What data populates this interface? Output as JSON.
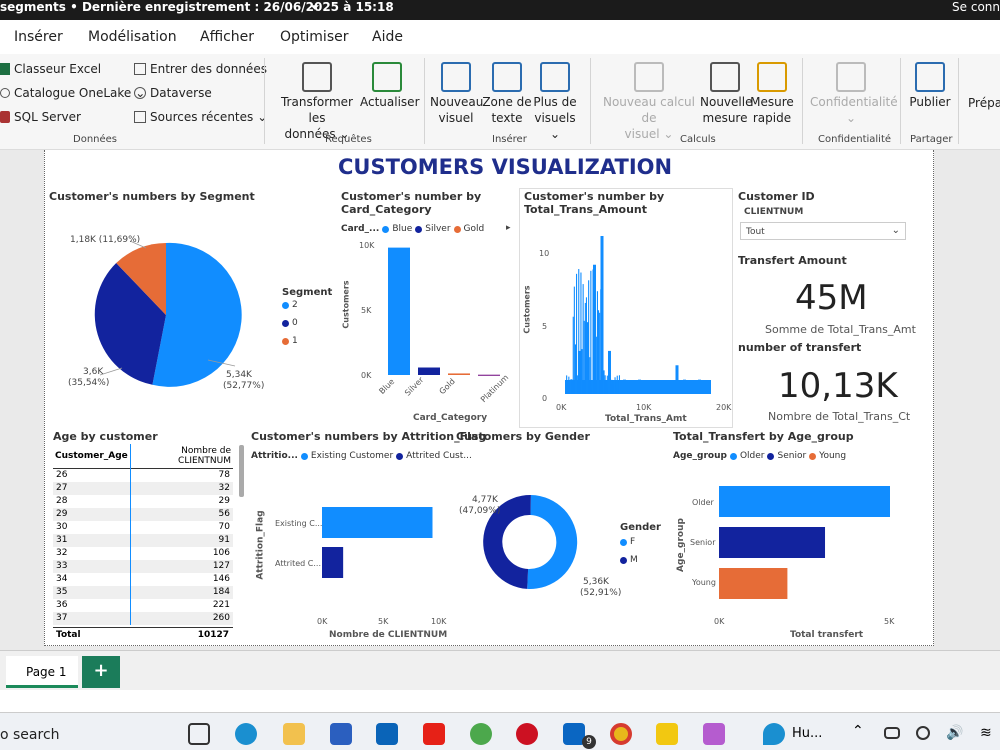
{
  "titlebar": {
    "title": "segments • Dernière enregistrement : 26/06/2025 à 15:18",
    "chevron": "⏷",
    "right": "Se conn"
  },
  "menu": {
    "items": [
      "Insérer",
      "Modélisation",
      "Afficher",
      "Optimiser",
      "Aide"
    ]
  },
  "ribbon": {
    "donnees": {
      "items": [
        "Classeur Excel",
        "Catalogue OneLake",
        "SQL Server",
        "Entrer des données",
        "Dataverse",
        "Sources récentes"
      ],
      "group": "Données"
    },
    "requetes": {
      "transform_line1": "Transformer les",
      "transform_line2": "données",
      "refresh": "Actualiser",
      "group": "Requêtes"
    },
    "inserer": {
      "new_visual_1": "Nouveau",
      "new_visual_2": "visuel",
      "textbox_1": "Zone de",
      "textbox_2": "texte",
      "more_1": "Plus de",
      "more_2": "visuels",
      "group": "Insérer"
    },
    "calculs": {
      "newcalc_1": "Nouveau calcul de",
      "newcalc_2": "visuel",
      "newmeasure_1": "Nouvelle",
      "newmeasure_2": "mesure",
      "quick_1": "Mesure",
      "quick_2": "rapide",
      "group": "Calculs"
    },
    "conf": {
      "label": "Confidentialité",
      "group": "Confidentialité"
    },
    "partager": {
      "label": "Publier",
      "group": "Partager"
    },
    "prep": "Prépa"
  },
  "report": {
    "title": "CUSTOMERS VISUALIZATION",
    "segment": {
      "title": "Customer's numbers by Segment",
      "legend_title": "Segment",
      "legend": [
        {
          "label": "2",
          "color": "#118DFF"
        },
        {
          "label": "0",
          "color": "#12239E"
        },
        {
          "label": "1",
          "color": "#E66C37"
        }
      ],
      "labels": [
        "1,18K (11,69%)",
        "3,6K",
        "(35,54%)",
        "5,34K",
        "(52,77%)"
      ]
    },
    "card": {
      "title": "Customer's number by Card_Category",
      "legend_title": "Card_...",
      "legend": [
        "Blue",
        "Silver",
        "Gold"
      ],
      "ylabel": "Customers",
      "xlabel": "Card_Category",
      "yticks": [
        "10K",
        "5K",
        "0K"
      ],
      "cats": [
        "Blue",
        "Silver",
        "Gold",
        "Platinum"
      ]
    },
    "trans": {
      "title": "Customer's number by Total_Trans_Amount",
      "ylabel": "Customers",
      "xlabel": "Total_Trans_Amt",
      "yticks": [
        "10",
        "5",
        "0"
      ],
      "xticks": [
        "0K",
        "10K",
        "20K"
      ]
    },
    "slicer": {
      "title": "Customer ID",
      "field": "CLIENTNUM",
      "value": "Tout"
    },
    "kpi": {
      "t1": "Transfert Amount",
      "v1": "45M",
      "c1": "Somme de Total_Trans_Amt",
      "t2": "number of transfert",
      "v2": "10,13K",
      "c2": "Nombre de Total_Trans_Ct"
    },
    "age": {
      "title": "Age by customer",
      "col1": "Customer_Age",
      "col2": "Nombre de CLIENTNUM",
      "rows": [
        [
          "26",
          "78"
        ],
        [
          "27",
          "32"
        ],
        [
          "28",
          "29"
        ],
        [
          "29",
          "56"
        ],
        [
          "30",
          "70"
        ],
        [
          "31",
          "91"
        ],
        [
          "32",
          "106"
        ],
        [
          "33",
          "127"
        ],
        [
          "34",
          "146"
        ],
        [
          "35",
          "184"
        ],
        [
          "36",
          "221"
        ],
        [
          "37",
          "260"
        ]
      ],
      "total_label": "Total",
      "total": "10127"
    },
    "attr": {
      "title": "Customer's numbers by Attrition_Flag",
      "legend_title": "Attritio...",
      "legend": [
        "Existing Customer",
        "Attrited Cust..."
      ],
      "ylabel": "Attrition_Flag",
      "xlabel": "Nombre de CLIENTNUM",
      "cats": [
        "Existing C...",
        "Attrited C..."
      ],
      "xticks": [
        "0K",
        "5K",
        "10K"
      ]
    },
    "gender": {
      "title": "Customers by Gender",
      "legend_title": "Gender",
      "legend": [
        "F",
        "M"
      ],
      "labels": [
        "4,77K",
        "(47,09%)",
        "5,36K",
        "(52,91%)"
      ]
    },
    "agegroup": {
      "title": "Total_Transfert by Age_group",
      "legend_title": "Age_group",
      "legend": [
        "Older",
        "Senior",
        "Young"
      ],
      "ylabel": "Age_group",
      "xlabel": "Total transfert",
      "cats": [
        "Older",
        "Senior",
        "Young"
      ],
      "xticks": [
        "0K",
        "5K"
      ]
    }
  },
  "pages": {
    "tab": "Page 1",
    "add": "+"
  },
  "taskbar": {
    "search": "o search",
    "hu": "Hu...",
    "badge": "9"
  },
  "chart_data": [
    {
      "type": "pie",
      "title": "Customer's numbers by Segment",
      "categories": [
        "2",
        "0",
        "1"
      ],
      "values": [
        5340,
        3600,
        1180
      ]
    },
    {
      "type": "bar",
      "title": "Customer's number by Card_Category",
      "categories": [
        "Blue",
        "Silver",
        "Gold",
        "Platinum"
      ],
      "values": [
        9436,
        555,
        116,
        20
      ],
      "ylim": [
        0,
        10000
      ]
    },
    {
      "type": "area",
      "title": "Customer's number by Total_Trans_Amount",
      "x": [
        0,
        1000,
        2000,
        3000,
        4000,
        5000,
        6000,
        8000,
        10000,
        15000,
        16000,
        18000
      ],
      "values": [
        0,
        1,
        3,
        5,
        9,
        11,
        3,
        1,
        1,
        2,
        1,
        1
      ],
      "ylim": [
        0,
        11
      ]
    },
    {
      "type": "bar",
      "title": "Customer's numbers by Attrition_Flag",
      "categories": [
        "Existing C...",
        "Attrited C..."
      ],
      "values": [
        8500,
        1627
      ],
      "xlim": [
        0,
        10000
      ]
    },
    {
      "type": "pie",
      "title": "Customers by Gender",
      "categories": [
        "F",
        "M"
      ],
      "values": [
        4770,
        5360
      ]
    },
    {
      "type": "bar",
      "title": "Total_Transfert by Age_group",
      "categories": [
        "Older",
        "Senior",
        "Young"
      ],
      "values": [
        5000,
        3100,
        2000
      ],
      "xlim": [
        0,
        5000
      ]
    }
  ]
}
